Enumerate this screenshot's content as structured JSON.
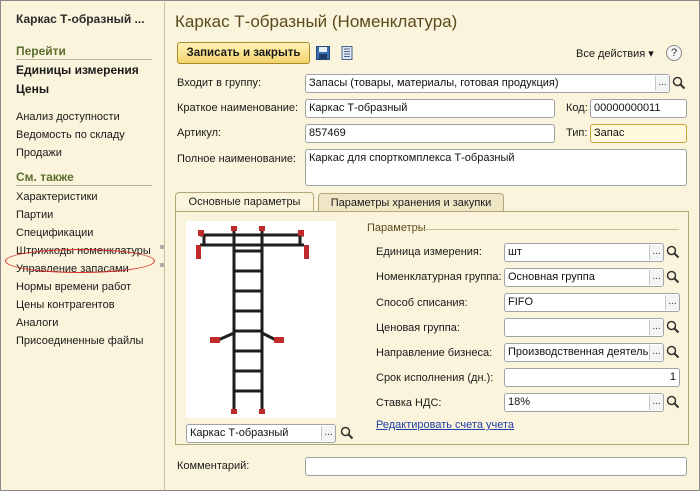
{
  "sidebar": {
    "title": "Каркас Т-образный ...",
    "goto_header": "Перейти",
    "goto_bold": [
      "Единицы измерения",
      "Цены"
    ],
    "goto_items": [
      "Анализ доступности",
      "Ведомость по складу",
      "Продажи"
    ],
    "see_also_header": "См. также",
    "see_also_items": [
      "Характеристики",
      "Партии",
      "Спецификации",
      "Штрихкоды номенклатуры",
      "Управление запасами",
      "Нормы времени работ",
      "Цены контрагентов",
      "Аналоги",
      "Присоединенные файлы"
    ]
  },
  "main": {
    "title": "Каркас Т-образный (Номенклатура)",
    "save_close": "Записать и закрыть",
    "all_actions": "Все действия ▾",
    "help": "?"
  },
  "form": {
    "group_label": "Входит в группу:",
    "group_value": "Запасы (товары, материалы, готовая продукция)",
    "short_name_label": "Краткое наименование:",
    "short_name_value": "Каркас Т-образный",
    "code_label": "Код:",
    "code_value": "00000000011",
    "article_label": "Артикул:",
    "article_value": "857469",
    "type_label": "Тип:",
    "type_value": "Запас",
    "full_name_label": "Полное наименование:",
    "full_name_value": "Каркас для спорткомплекса Т-образный",
    "comment_label": "Комментарий:",
    "comment_value": ""
  },
  "tabs": [
    "Основные параметры",
    "Параметры хранения и закупки"
  ],
  "params": {
    "header": "Параметры",
    "picture_caption": "Каркас Т-образный",
    "unit_label": "Единица измерения:",
    "unit_value": "шт",
    "nom_group_label": "Номенклатурная группа:",
    "nom_group_value": "Основная группа",
    "writeoff_label": "Способ списания:",
    "writeoff_value": "FIFO",
    "price_group_label": "Ценовая группа:",
    "price_group_value": "",
    "business_label": "Направление бизнеса:",
    "business_value": "Производственная деятельность",
    "term_label": "Срок исполнения (дн.):",
    "term_value": "1",
    "vat_label": "Ставка НДС:",
    "vat_value": "18%",
    "edit_accounts_link": "Редактировать счета учета"
  },
  "colors": {
    "background": "#fbf4dc",
    "title": "#5a4a1c",
    "section": "#5a6e2e",
    "link": "#1f3ea8",
    "highlight": "#d62b2b"
  }
}
